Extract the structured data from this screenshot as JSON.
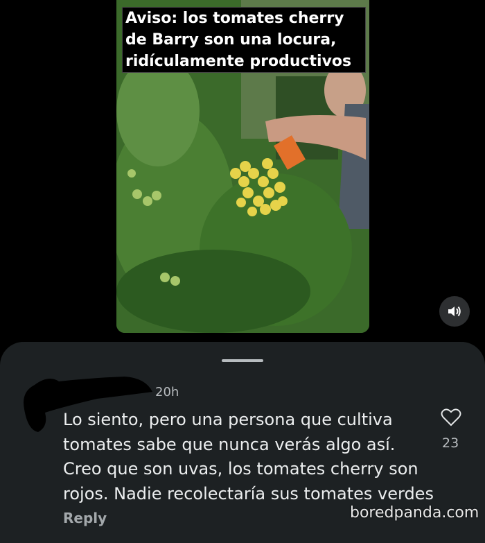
{
  "video": {
    "caption": "Aviso: los tomates cherry de Barry son una locura, ridículamente productivos",
    "sound_icon": "speaker-volume-icon"
  },
  "comment": {
    "timestamp": "20h",
    "text": "Lo siento, pero una persona que cultiva\ntomates sabe que nunca verás algo así.\nCreo que son uvas, los tomates cherry son\nrojos. Nadie recolectaría sus tomates verdes",
    "like_icon": "heart-outline-icon",
    "like_count": "23",
    "reply_label": "Reply"
  },
  "watermark": "boredpanda.com",
  "colors": {
    "sheet_background": "#1d2123",
    "page_background": "#000000"
  }
}
